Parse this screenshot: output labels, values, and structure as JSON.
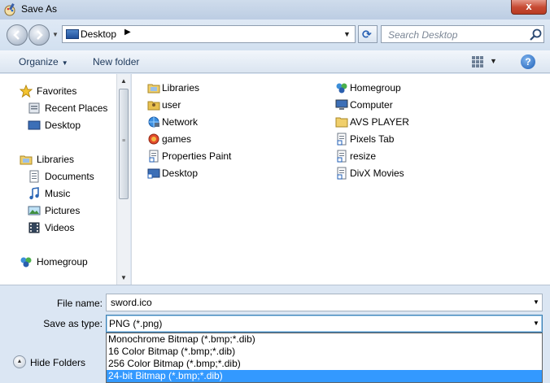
{
  "window": {
    "title": "Save As",
    "close_label": "x"
  },
  "address": {
    "location": "Desktop",
    "separator": "▶",
    "search_placeholder": "Search Desktop"
  },
  "toolbar": {
    "organize": "Organize",
    "new_folder": "New folder",
    "help": "?"
  },
  "nav_tree": {
    "favorites": {
      "label": "Favorites",
      "items": [
        "Recent Places",
        "Desktop"
      ]
    },
    "libraries": {
      "label": "Libraries",
      "items": [
        "Documents",
        "Music",
        "Pictures",
        "Videos"
      ]
    },
    "homegroup": {
      "label": "Homegroup"
    }
  },
  "files": {
    "col1": [
      {
        "name": "Libraries",
        "icon": "libraries-folder-icon"
      },
      {
        "name": "user",
        "icon": "user-folder-icon"
      },
      {
        "name": "Network",
        "icon": "network-icon"
      },
      {
        "name": "games",
        "icon": "games-icon"
      },
      {
        "name": "Properties Paint",
        "icon": "shortcut-icon"
      },
      {
        "name": "Desktop",
        "icon": "desktop-shortcut-icon"
      }
    ],
    "col2": [
      {
        "name": "Homegroup",
        "icon": "homegroup-icon"
      },
      {
        "name": "Computer",
        "icon": "computer-icon"
      },
      {
        "name": "AVS PLAYER",
        "icon": "folder-icon"
      },
      {
        "name": "Pixels Tab",
        "icon": "shortcut-icon"
      },
      {
        "name": "resize",
        "icon": "shortcut-icon"
      },
      {
        "name": "DivX Movies",
        "icon": "shortcut-icon"
      }
    ]
  },
  "save_form": {
    "file_name_label": "File name:",
    "file_name_value": "sword.ico",
    "save_type_label": "Save as type:",
    "save_type_value": "PNG (*.png)",
    "type_options": [
      "Monochrome Bitmap (*.bmp;*.dib)",
      "16 Color Bitmap (*.bmp;*.dib)",
      "256 Color Bitmap (*.bmp;*.dib)",
      "24-bit Bitmap (*.bmp;*.dib)"
    ],
    "highlighted_option_index": 3,
    "hide_folders_label": "Hide Folders"
  },
  "colors": {
    "accent": "#3399ff",
    "chrome": "#dbe6f3",
    "link_text": "#1e395b"
  }
}
